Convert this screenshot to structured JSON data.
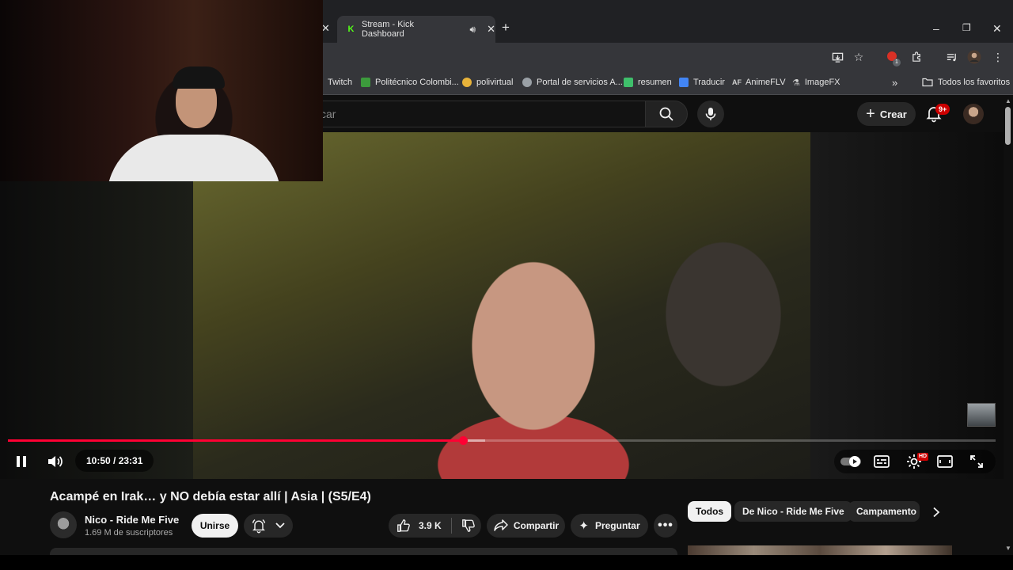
{
  "browser": {
    "tabs": [
      {
        "label": "Stream - Kick Dashboard",
        "favicon": "kick-icon",
        "active": true
      }
    ],
    "new_tab_symbol": "+",
    "bookmarks": [
      {
        "label": "Twitch",
        "color": "#9146ff"
      },
      {
        "label": "Politécnico Colombi...",
        "color": "#3c9a3c"
      },
      {
        "label": "polivirtual",
        "color": "#e8b33a"
      },
      {
        "label": "Portal de servicios A...",
        "color": "#9aa0a6"
      },
      {
        "label": "resumen",
        "color": "#3fbf6b"
      },
      {
        "label": "Traducir",
        "color": "#4285f4"
      },
      {
        "label": "AnimeFLV",
        "color": "#d1d1d1"
      },
      {
        "label": "ImageFX",
        "color": "#d1d1d1"
      }
    ],
    "bookmarks_more": "»",
    "all_bookmarks": "Todos los favoritos",
    "extension_badge": "1"
  },
  "youtube": {
    "search_placeholder": "car",
    "create_label": "Crear",
    "notifications_badge": "9+"
  },
  "player": {
    "current_time": "10:50",
    "duration": "23:31",
    "time_display": "10:50 / 23:31",
    "progress_fraction": 0.461,
    "buffered_fraction": 0.483,
    "hd_badge": "HD"
  },
  "video": {
    "title": "Acampé en Irak… y NO debía estar allí | Asia | (S5/E4)",
    "channel": "Nico - Ride Me Five",
    "subscribers": "1.69 M de suscriptores",
    "join_label": "Unirse",
    "likes": "3.9 K",
    "share_label": "Compartir",
    "ask_label": "Preguntar"
  },
  "chips": [
    {
      "label": "Todos",
      "active": true
    },
    {
      "label": "De Nico - Ride Me Five",
      "active": false
    },
    {
      "label": "Campamento",
      "active": false
    }
  ],
  "colors": {
    "youtube_red": "#ff0033",
    "background": "#0f0f0f",
    "kick_green": "#53fc18"
  }
}
